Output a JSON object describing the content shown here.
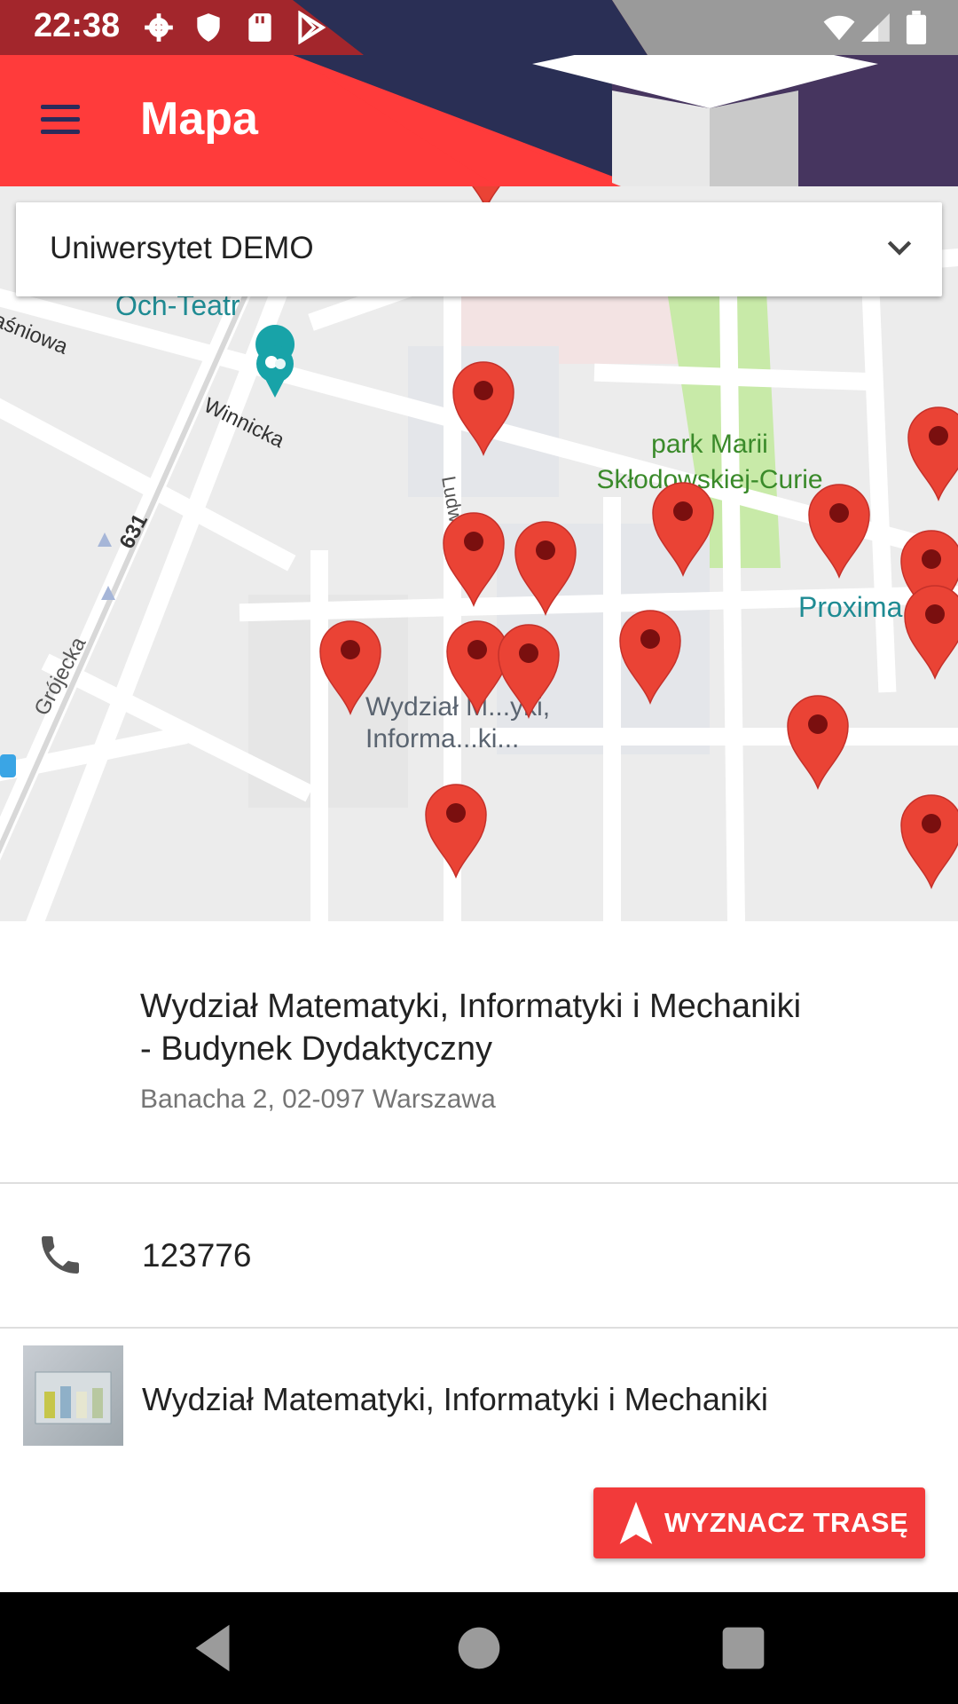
{
  "status_bar": {
    "time": "22:38",
    "icons": [
      "settings-icon",
      "shield-icon",
      "sd-card-icon",
      "play-store-icon",
      "wifi-icon",
      "signal-icon",
      "battery-icon"
    ]
  },
  "app_bar": {
    "title": "Mapa",
    "menu_icon": "menu-icon"
  },
  "campus_selector": {
    "selected": "Uniwersytet DEMO"
  },
  "map": {
    "labels": {
      "theatre": "Och-Teatr",
      "park": "park Marii\nSkłodowskiej-Curie",
      "street_ludwika": "Ludwika",
      "street_winnicka": "Winnicka",
      "street_grojecka": "Grójecka",
      "street_wisniowa": "aśniowa",
      "road_631": "631",
      "proxima": "Proxima",
      "faculty_label": "Wydział M...yki,\nInforma...ki..."
    }
  },
  "place": {
    "title": "Wydział Matematyki, Informatyki i Mechaniki - Budynek Dydaktyczny",
    "address": "Banacha 2, 02-097 Warszawa",
    "phone": "123776",
    "faculty": "Wydział Matematyki, Informatyki i Mechaniki"
  },
  "actions": {
    "route_button": "WYZNACZ TRASĘ"
  },
  "colors": {
    "accent": "#ff3b3b",
    "status_bar": "#a3262c",
    "pin": "#ea4335",
    "button": "#f23a3a"
  }
}
